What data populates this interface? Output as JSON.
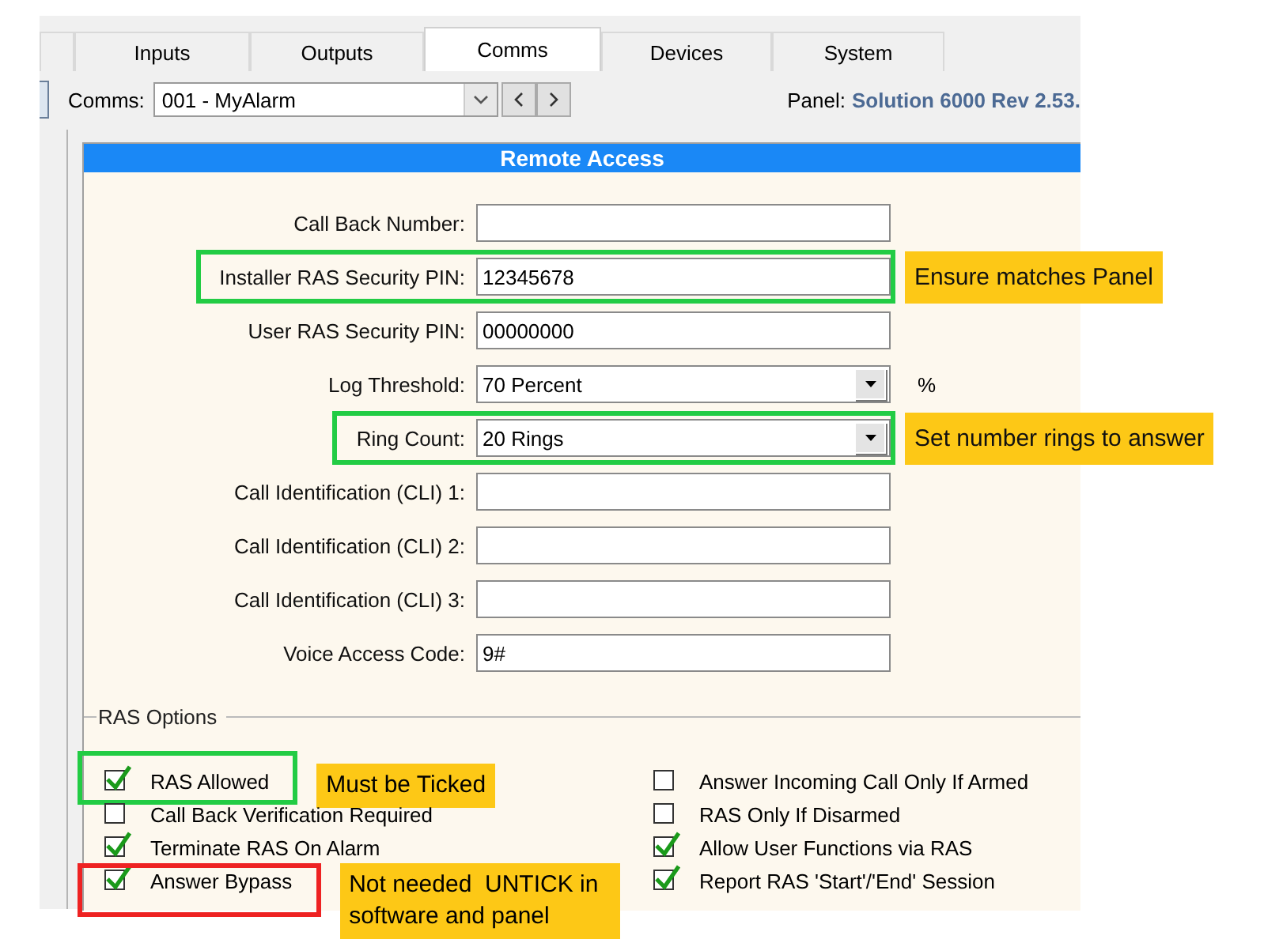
{
  "tabs": [
    {
      "selected": false
    },
    {
      "label": "Inputs",
      "selected": false
    },
    {
      "label": "Outputs",
      "selected": false
    },
    {
      "label": "Comms",
      "selected": true
    },
    {
      "label": "Devices",
      "selected": false
    },
    {
      "label": "System",
      "selected": false
    }
  ],
  "comms_bar": {
    "label": "Comms:",
    "value": "001 - MyAlarm",
    "panel_label": "Panel:",
    "panel_value": "Solution 6000 Rev 2.53."
  },
  "section": {
    "title": "Remote Access"
  },
  "fields": [
    {
      "label": "Call Back Number:",
      "kind": "text"
    },
    {
      "label": "Installer RAS Security PIN:",
      "value": "12345678",
      "kind": "text",
      "annotation": {
        "text": "Ensure matches Panel",
        "color": "#22cc44"
      }
    },
    {
      "label": "User RAS Security PIN:",
      "value": "00000000",
      "kind": "text"
    },
    {
      "label": "Log Threshold:",
      "value": "70 Percent",
      "kind": "dropdown",
      "unit": "%"
    },
    {
      "label": "Ring Count:",
      "value": "20 Rings",
      "kind": "dropdown",
      "annotation": {
        "text": "Set number rings to answer",
        "color": "#22cc44"
      }
    },
    {
      "label": "Call Identification (CLI) 1:",
      "kind": "text"
    },
    {
      "label": "Call Identification (CLI) 2:",
      "kind": "text"
    },
    {
      "label": "Call Identification (CLI) 3:",
      "kind": "text"
    },
    {
      "label": "Voice Access Code:",
      "value": "9#",
      "kind": "text"
    }
  ],
  "ras_options": {
    "title": "RAS Options",
    "left": [
      {
        "label": "RAS Allowed",
        "checked": true,
        "annotation": {
          "text": "Must be Ticked",
          "color": "#22cc44"
        }
      },
      {
        "label": "Call Back Verification Required",
        "checked": false
      },
      {
        "label": "Terminate RAS On Alarm",
        "checked": true
      },
      {
        "label": "Answer Bypass",
        "checked": true,
        "annotation": {
          "text": "Not needed  UNTICK in software and panel",
          "color": "#ee2222"
        }
      }
    ],
    "right": [
      {
        "label": "Answer Incoming Call Only If Armed",
        "checked": false
      },
      {
        "label": "RAS Only If Disarmed",
        "checked": false
      },
      {
        "label": "Allow User Functions via RAS",
        "checked": true
      },
      {
        "label": "Report RAS 'Start'/'End' Session",
        "checked": true
      }
    ]
  }
}
